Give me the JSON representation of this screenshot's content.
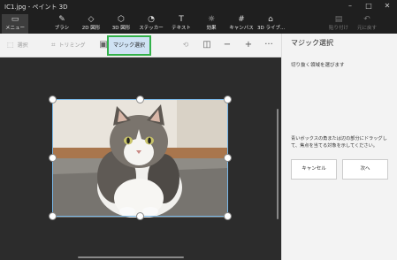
{
  "window": {
    "title": "IC1.jpg - ペイント 3D",
    "controls": [
      "minimize",
      "maximize",
      "close"
    ]
  },
  "ribbon": {
    "items": [
      {
        "label": "メニュー",
        "icon": "folder-icon"
      },
      {
        "label": "ブラシ",
        "icon": "brush-icon"
      },
      {
        "label": "2D 図形",
        "icon": "shapes-2d-icon"
      },
      {
        "label": "3D 図形",
        "icon": "cube-icon"
      },
      {
        "label": "ステッカー",
        "icon": "sticker-icon"
      },
      {
        "label": "テキスト",
        "icon": "text-icon"
      },
      {
        "label": "効果",
        "icon": "effects-icon"
      },
      {
        "label": "キャンバス",
        "icon": "canvas-icon"
      },
      {
        "label": "3D ライブ...",
        "icon": "3d-library-icon"
      },
      {
        "label": "貼り付け",
        "icon": "paste-icon"
      },
      {
        "label": "元に戻す",
        "icon": "undo-icon"
      }
    ]
  },
  "toolbar": {
    "select_label": "選択",
    "crop_label": "トリミング",
    "magic_select_label": "マジック選択",
    "zoom_minus": "−",
    "zoom_plus": "+",
    "more": "···"
  },
  "panel": {
    "title": "マジック選択",
    "subtitle": "切り抜く領域を選びます",
    "description": "青いボックスの角または辺の部分にドラッグして、焦点を当てる対象を示してください。",
    "cancel_label": "キャンセル",
    "next_label": "次へ"
  }
}
